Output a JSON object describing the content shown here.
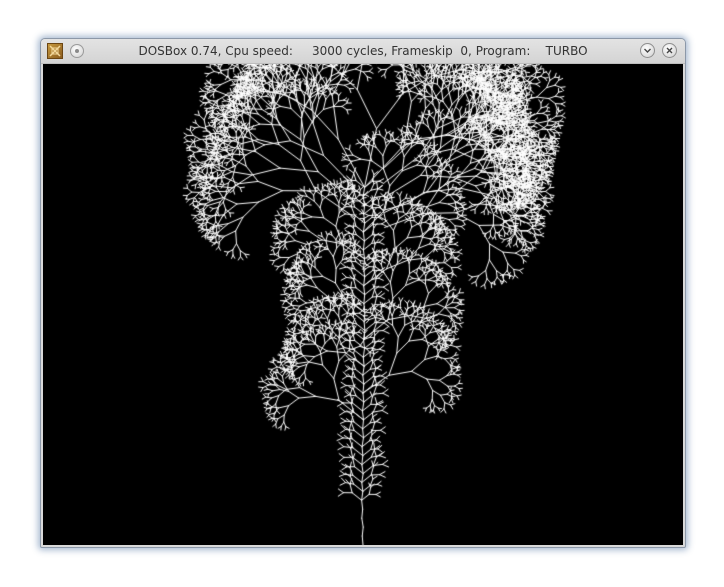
{
  "window": {
    "title": "DOSBox 0.74, Cpu speed:     3000 cycles, Frameskip  0, Program:    TURBO",
    "app_icon": "dosbox-icon",
    "menu_icon": "window-menu-icon",
    "minimize_icon": "chevron-down-icon",
    "close_icon": "close-icon"
  },
  "screen": {
    "background": "#000000",
    "drawing": "white fractal tree",
    "stroke_color": "#ffffff"
  }
}
